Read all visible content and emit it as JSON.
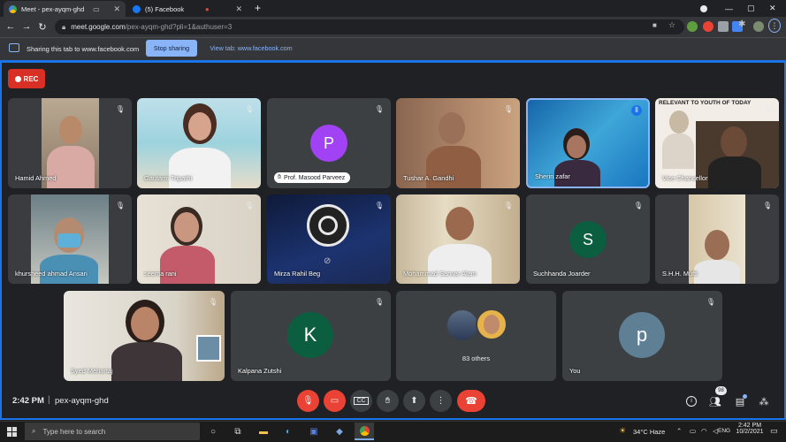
{
  "browser": {
    "tabs": [
      {
        "title": "Meet - pex-ayqm-ghd",
        "active": true
      },
      {
        "title": "(5) Facebook",
        "active": false
      }
    ],
    "url_host": "meet.google.com",
    "url_path": "/pex-ayqm-ghd?pli=1&authuser=3",
    "share_notice": "Sharing this tab to www.facebook.com",
    "stop_sharing": "Stop sharing",
    "view_tab": "View tab: www.facebook.com"
  },
  "meet": {
    "rec_label": "REC",
    "participants": [
      {
        "name": "Hamid Ahmed"
      },
      {
        "name": "Gautami Tripathi"
      },
      {
        "name": "Prof. Masood Parveez",
        "initial": "P",
        "color": "#a142f4"
      },
      {
        "name": "Tushar A. Gandhi"
      },
      {
        "name": "Sherin zafar"
      },
      {
        "name": "Vice Chancellor",
        "banner": "RELEVANT TO YOUTH OF TODAY"
      },
      {
        "name": "khursheed ahmad Ansari"
      },
      {
        "name": "seema rani"
      },
      {
        "name": "Mirza Rahil Beg"
      },
      {
        "name": "Mohammad Sarwar Alam"
      },
      {
        "name": "Suchhanda Joarder",
        "initial": "S",
        "color": "#0b5e3f"
      },
      {
        "name": "S.H.H. Mufti"
      },
      {
        "name": "Syed Mehartaj"
      },
      {
        "name": "Kalpana Zutshi",
        "initial": "K",
        "color": "#0b5e3f"
      },
      {
        "name": "83 others"
      },
      {
        "name": "You",
        "initial": "p",
        "color": "#5f7f95"
      }
    ],
    "time": "2:42 PM",
    "separator": "|",
    "meeting_code": "pex-ayqm-ghd",
    "people_count": "98"
  },
  "taskbar": {
    "search_placeholder": "Type here to search",
    "weather": "34°C Haze",
    "lang": "ENG",
    "clock_time": "2:42 PM",
    "clock_date": "10/2/2021"
  }
}
